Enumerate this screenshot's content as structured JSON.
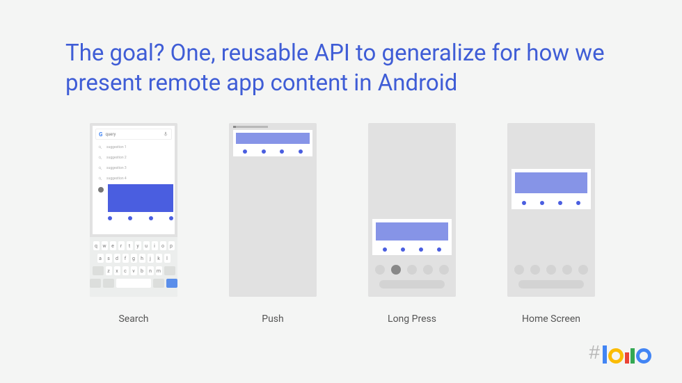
{
  "title": "The goal? One, reusable API to generalize for how we present remote app content in Android",
  "captions": {
    "search": "Search",
    "push": "Push",
    "longpress": "Long Press",
    "homescreen": "Home Screen"
  },
  "search": {
    "query": "query",
    "suggestions": [
      "suggestion 1",
      "suggestion 2",
      "suggestion 3",
      "suggestion 4"
    ]
  },
  "keyboard": {
    "row1": [
      "q",
      "w",
      "e",
      "r",
      "t",
      "y",
      "u",
      "i",
      "o",
      "p"
    ],
    "row2": [
      "a",
      "s",
      "d",
      "f",
      "g",
      "h",
      "j",
      "k",
      "l"
    ],
    "row3": [
      "z",
      "x",
      "c",
      "v",
      "b",
      "n",
      "m"
    ]
  },
  "hashtag": "#"
}
